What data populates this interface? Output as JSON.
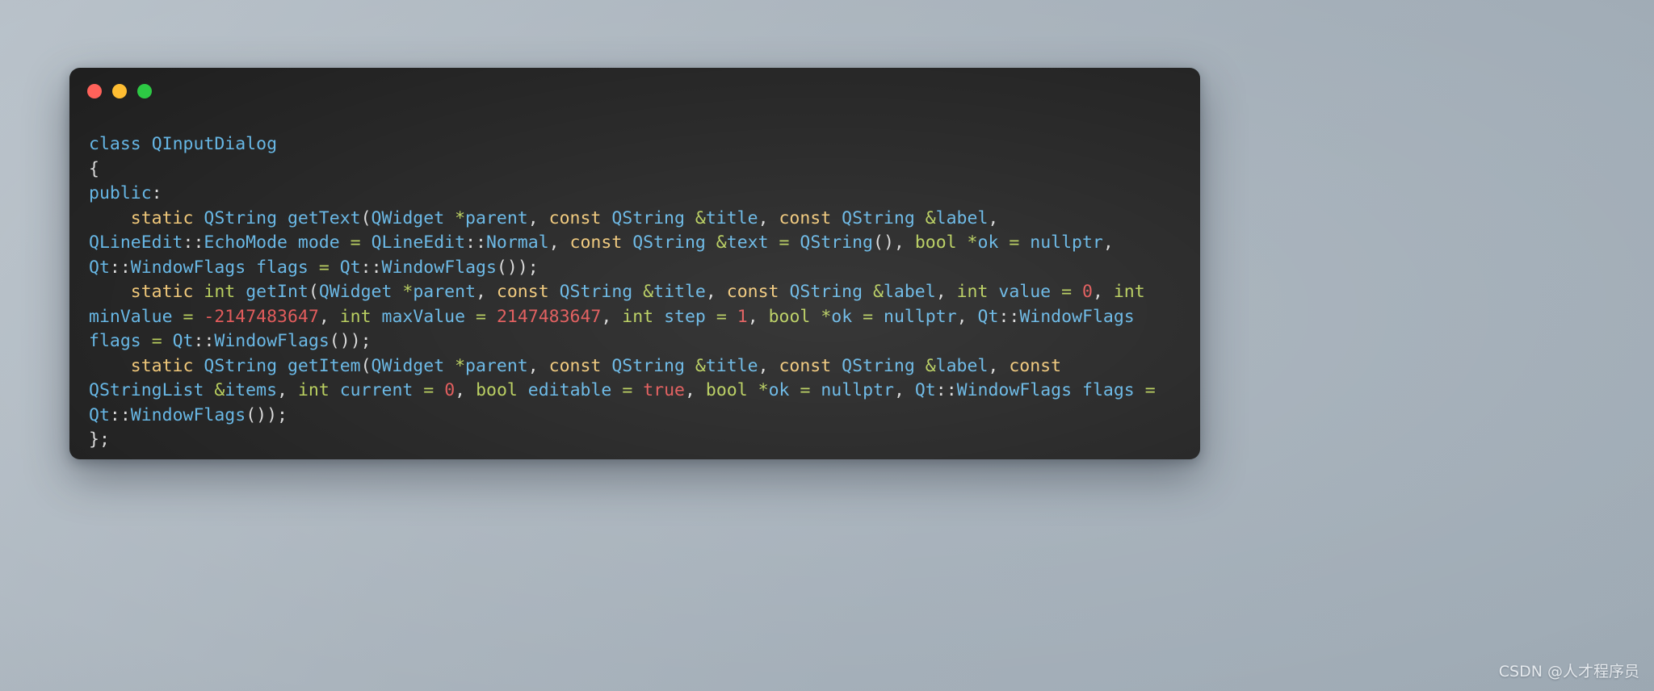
{
  "window": {
    "title_bar": {
      "buttons": [
        {
          "name": "close",
          "color": "#ff5f57"
        },
        {
          "name": "minimize",
          "color": "#febc2e"
        },
        {
          "name": "zoom",
          "color": "#28c840"
        }
      ]
    },
    "background_color": "#1c1c1c"
  },
  "theme": {
    "page_background_from": "#b9c2ca",
    "page_background_to": "#9fabb5",
    "punctuation": "#d8d8d8",
    "type": "#61b4e4",
    "identifier": "#61b4e4",
    "keyword": "#f0c674",
    "primitive": "#b5cc56",
    "operator": "#b5cc56",
    "number": "#e05252",
    "boolean": "#e05252"
  },
  "code": {
    "language": "C++",
    "plain_text": "class QInputDialog\n{\npublic:\n    static QString getText(QWidget *parent, const QString &title, const QString &label, QLineEdit::EchoMode mode = QLineEdit::Normal, const QString &text = QString(), bool *ok = nullptr, Qt::WindowFlags flags = Qt::WindowFlags());\n    static int getInt(QWidget *parent, const QString &title, const QString &label, int value = 0, int minValue = -2147483647, int maxValue = 2147483647, int step = 1, bool *ok = nullptr, Qt::WindowFlags flags = Qt::WindowFlags());\n    static QString getItem(QWidget *parent, const QString &title, const QString &label, const QStringList &items, int current = 0, bool editable = true, bool *ok = nullptr, Qt::WindowFlags flags = Qt::WindowFlags());\n};",
    "lines": [
      {
        "index": 1,
        "text": "class QInputDialog",
        "tokens": [
          {
            "t": "class",
            "c": "kw-blue"
          },
          {
            "t": " ",
            "c": "plain"
          },
          {
            "t": "QInputDialog",
            "c": "type"
          }
        ]
      },
      {
        "index": 2,
        "text": "{",
        "tokens": [
          {
            "t": "{",
            "c": "punc"
          }
        ]
      },
      {
        "index": 3,
        "text": "public:",
        "tokens": [
          {
            "t": "public",
            "c": "kw-blue"
          },
          {
            "t": ":",
            "c": "punc"
          }
        ]
      },
      {
        "index": 4,
        "text": "    static QString getText(QWidget *parent, const QString &title, const QString &label, QLineEdit::EchoMode mode = QLineEdit::Normal, const QString &text = QString(), bool *ok = nullptr, Qt::WindowFlags flags = Qt::WindowFlags());"
      },
      {
        "index": 5,
        "text": "    static int getInt(QWidget *parent, const QString &title, const QString &label, int value = 0, int minValue = -2147483647, int maxValue = 2147483647, int step = 1, bool *ok = nullptr, Qt::WindowFlags flags = Qt::WindowFlags());"
      },
      {
        "index": 6,
        "text": "    static QString getItem(QWidget *parent, const QString &title, const QString &label, const QStringList &items, int current = 0, bool editable = true, bool *ok = nullptr, Qt::WindowFlags flags = Qt::WindowFlags());"
      },
      {
        "index": 7,
        "text": "};"
      }
    ],
    "symbols": {
      "class_name": "QInputDialog",
      "access_specifier": "public:",
      "methods": [
        {
          "name": "getText",
          "return_type": "QString",
          "storage": "static",
          "parameters": [
            {
              "type": "QWidget",
              "ptr": "*",
              "name": "parent"
            },
            {
              "qualifier": "const",
              "type": "QString",
              "ref": "&",
              "name": "title"
            },
            {
              "qualifier": "const",
              "type": "QString",
              "ref": "&",
              "name": "label"
            },
            {
              "type": "QLineEdit::EchoMode",
              "name": "mode",
              "default": "QLineEdit::Normal"
            },
            {
              "qualifier": "const",
              "type": "QString",
              "ref": "&",
              "name": "text",
              "default": "QString()"
            },
            {
              "type": "bool",
              "ptr": "*",
              "name": "ok",
              "default": "nullptr"
            },
            {
              "type": "Qt::WindowFlags",
              "name": "flags",
              "default": "Qt::WindowFlags()"
            }
          ]
        },
        {
          "name": "getInt",
          "return_type": "int",
          "storage": "static",
          "parameters": [
            {
              "type": "QWidget",
              "ptr": "*",
              "name": "parent"
            },
            {
              "qualifier": "const",
              "type": "QString",
              "ref": "&",
              "name": "title"
            },
            {
              "qualifier": "const",
              "type": "QString",
              "ref": "&",
              "name": "label"
            },
            {
              "type": "int",
              "name": "value",
              "default": "0"
            },
            {
              "type": "int",
              "name": "minValue",
              "default": "-2147483647"
            },
            {
              "type": "int",
              "name": "maxValue",
              "default": "2147483647"
            },
            {
              "type": "int",
              "name": "step",
              "default": "1"
            },
            {
              "type": "bool",
              "ptr": "*",
              "name": "ok",
              "default": "nullptr"
            },
            {
              "type": "Qt::WindowFlags",
              "name": "flags",
              "default": "Qt::WindowFlags()"
            }
          ]
        },
        {
          "name": "getItem",
          "return_type": "QString",
          "storage": "static",
          "parameters": [
            {
              "type": "QWidget",
              "ptr": "*",
              "name": "parent"
            },
            {
              "qualifier": "const",
              "type": "QString",
              "ref": "&",
              "name": "title"
            },
            {
              "qualifier": "const",
              "type": "QString",
              "ref": "&",
              "name": "label"
            },
            {
              "qualifier": "const",
              "type": "QStringList",
              "ref": "&",
              "name": "items"
            },
            {
              "type": "int",
              "name": "current",
              "default": "0"
            },
            {
              "type": "bool",
              "name": "editable",
              "default": "true"
            },
            {
              "type": "bool",
              "ptr": "*",
              "name": "ok",
              "default": "nullptr"
            },
            {
              "type": "Qt::WindowFlags",
              "name": "flags",
              "default": "Qt::WindowFlags()"
            }
          ]
        }
      ]
    }
  },
  "watermark": {
    "text": "CSDN @人才程序员"
  }
}
